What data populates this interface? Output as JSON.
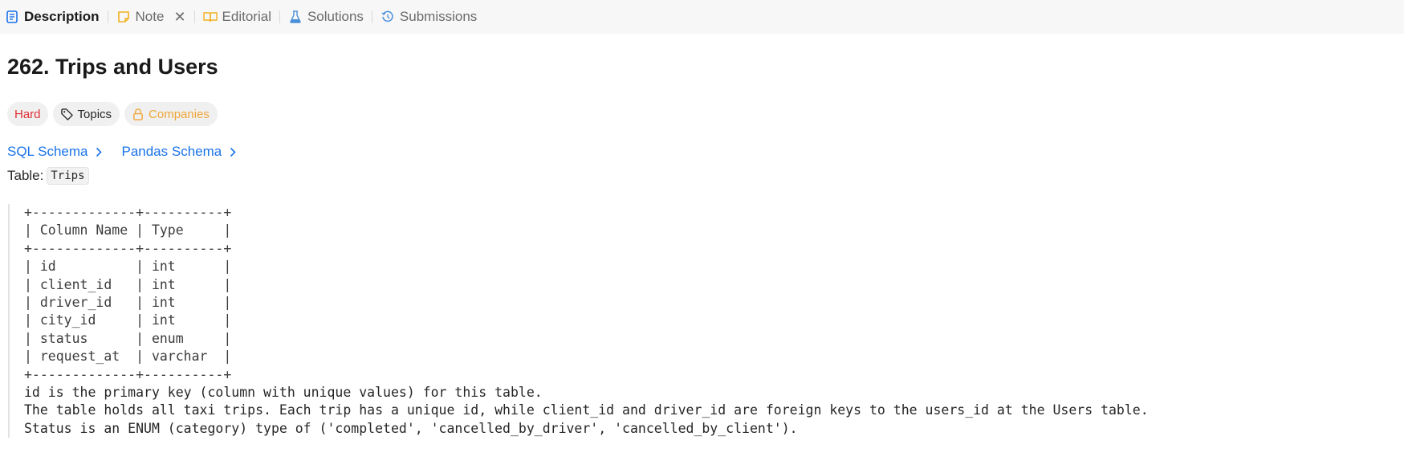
{
  "tabs": [
    {
      "label": "Description",
      "icon": "description-icon"
    },
    {
      "label": "Note",
      "icon": "note-icon"
    },
    {
      "label": "Editorial",
      "icon": "book-icon"
    },
    {
      "label": "Solutions",
      "icon": "flask-icon"
    },
    {
      "label": "Submissions",
      "icon": "history-icon"
    }
  ],
  "problem": {
    "title": "262. Trips and Users",
    "difficulty": "Hard",
    "topics_label": "Topics",
    "companies_label": "Companies",
    "sql_schema": "SQL Schema",
    "pandas_schema": "Pandas Schema",
    "table_prefix": "Table:",
    "table_name": "Trips"
  },
  "schema_table": {
    "border": "+-------------+----------+",
    "header": "| Column Name | Type     |",
    "rows": [
      "| id          | int      |",
      "| client_id   | int      |",
      "| driver_id   | int      |",
      "| city_id     | int      |",
      "| status      | enum     |",
      "| request_at  | varchar  |"
    ]
  },
  "description_lines": [
    "id is the primary key (column with unique values) for this table.",
    "The table holds all taxi trips. Each trip has a unique id, while client_id and driver_id are foreign keys to the users_id at the Users table.",
    "Status is an ENUM (category) type of ('completed', 'cancelled_by_driver', 'cancelled_by_client')."
  ],
  "colors": {
    "accent_blue": "#1a73e8",
    "hard_red": "#e0323a",
    "companies_orange": "#f0a63a",
    "note_yellow": "#f2b01e"
  }
}
